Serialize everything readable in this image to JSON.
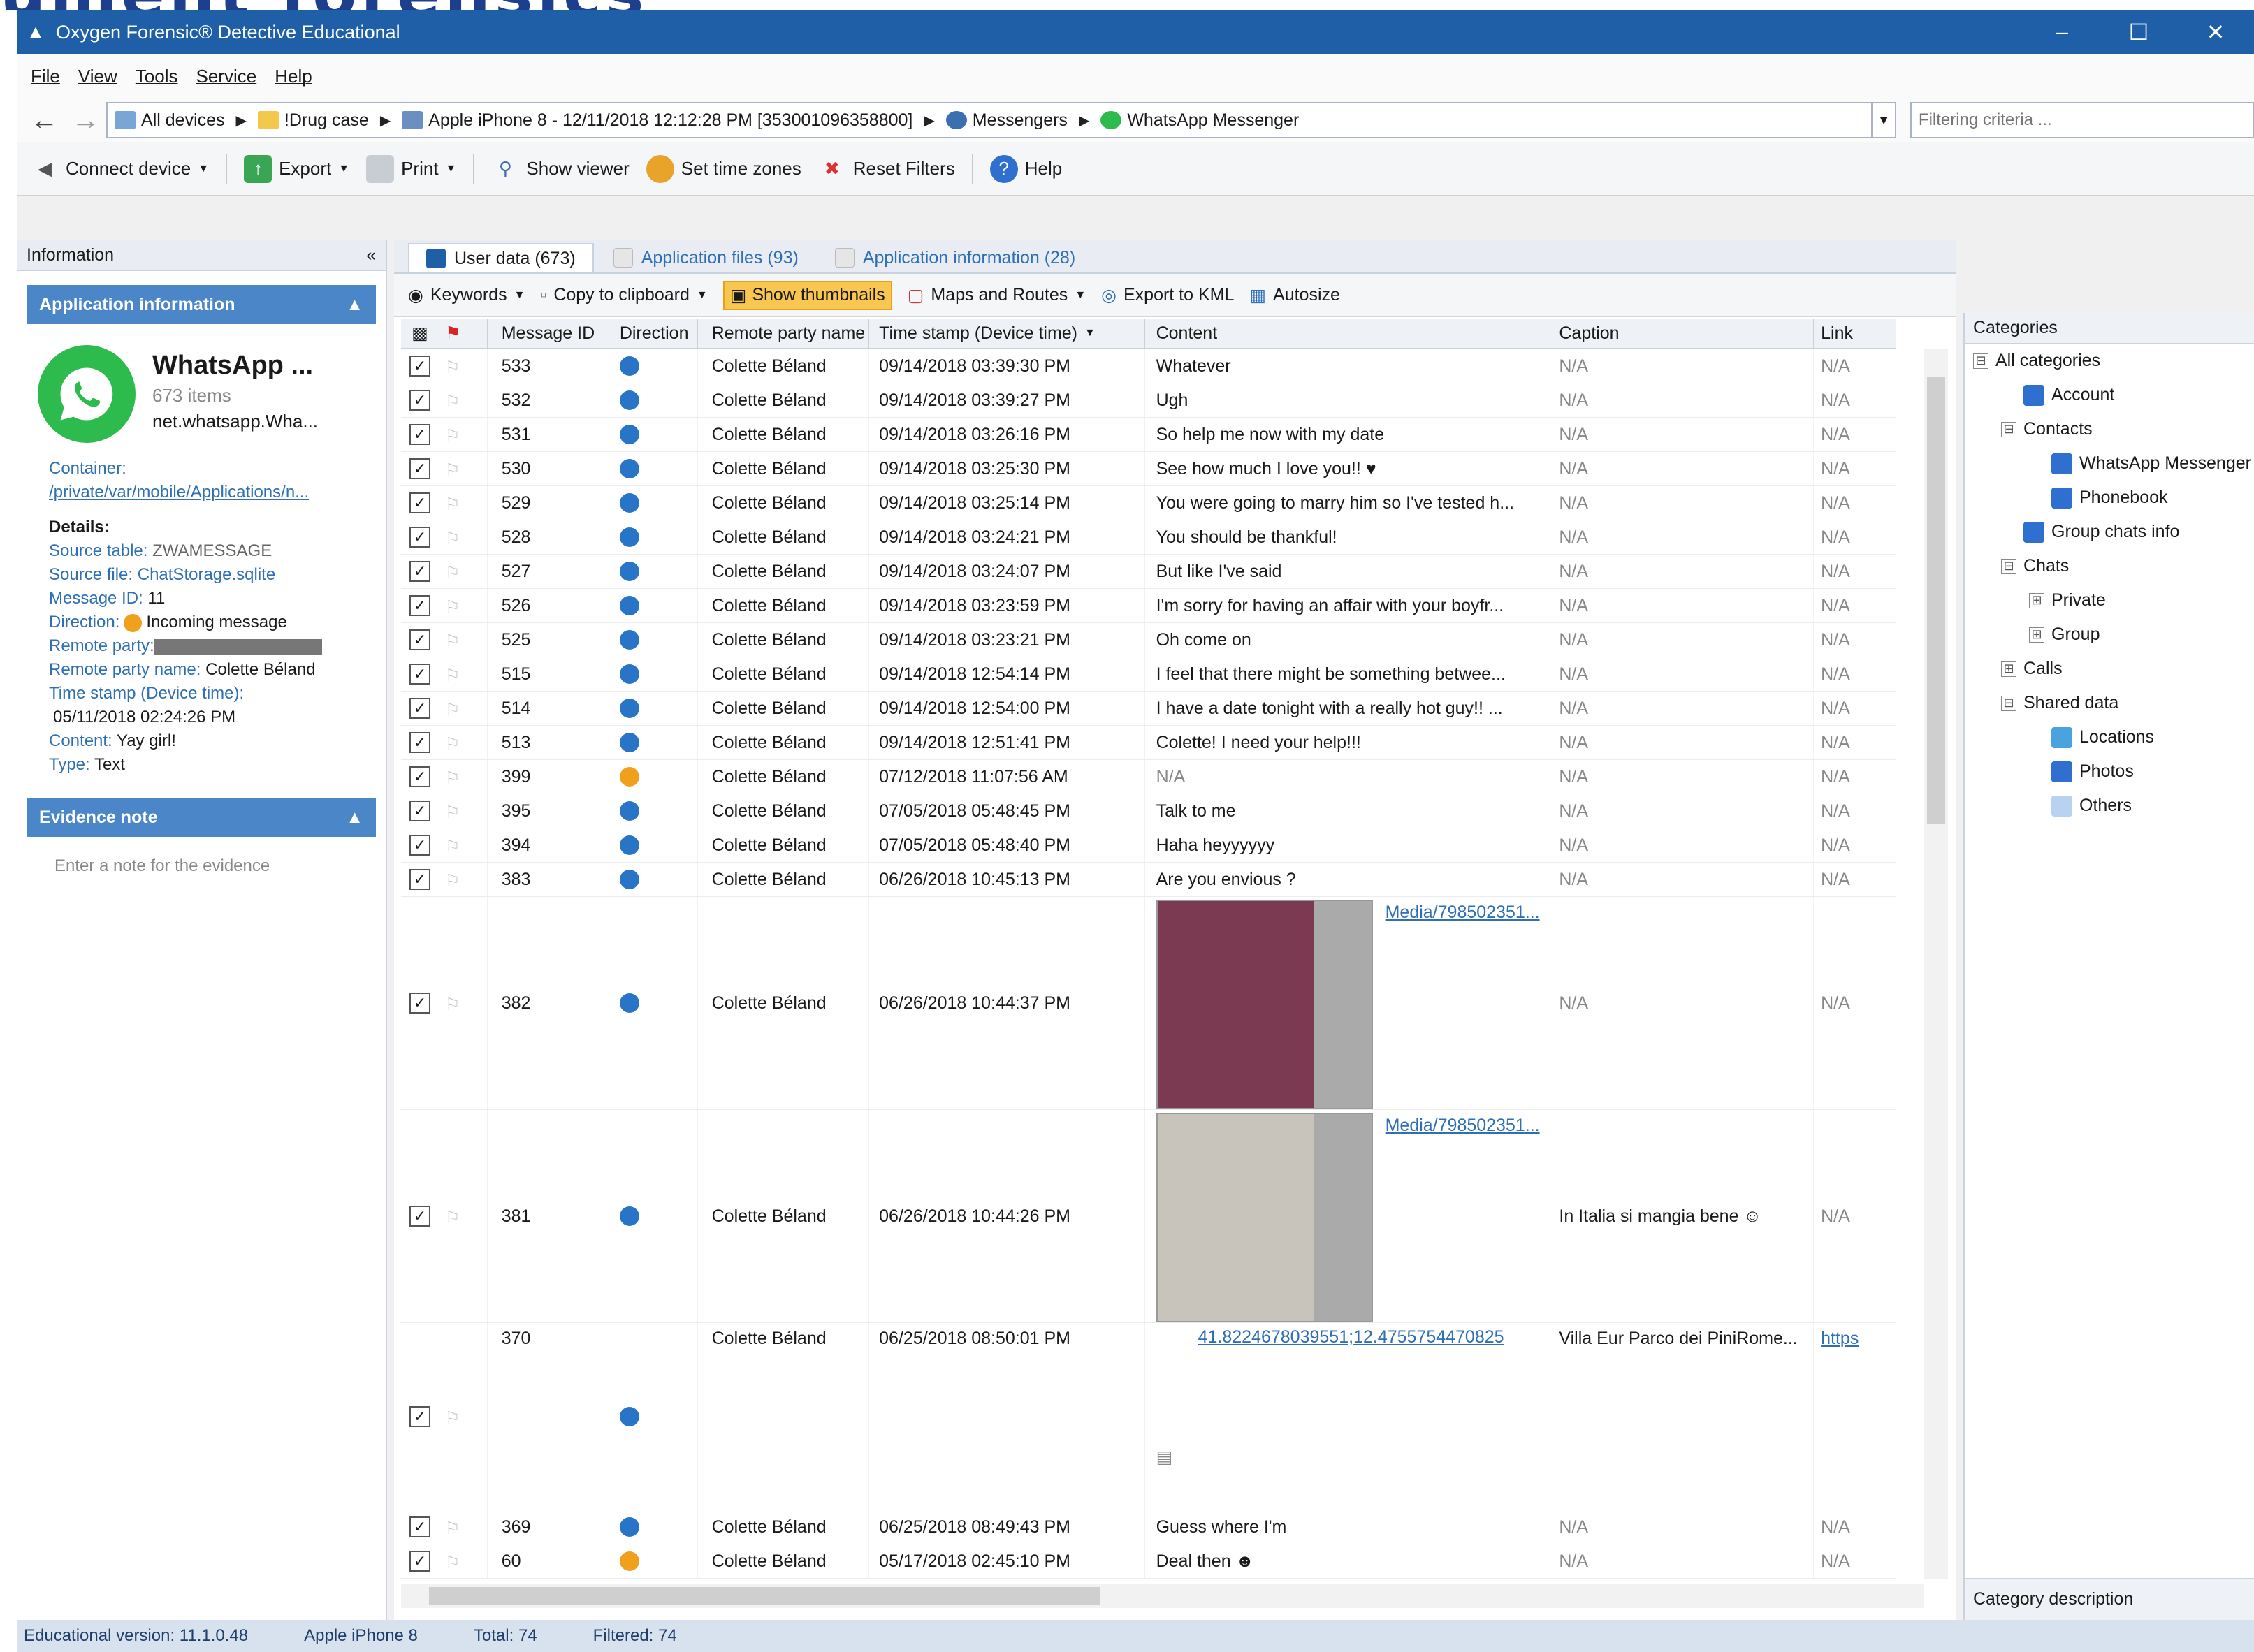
{
  "window": {
    "title": "Oxygen Forensic® Detective Educational",
    "controls": [
      "–",
      "☐",
      "✕"
    ]
  },
  "menu": [
    "File",
    "View",
    "Tools",
    "Service",
    "Help"
  ],
  "breadcrumb": {
    "items": [
      {
        "label": "All devices",
        "icon": "devices-icon",
        "color": "#7aa6d6"
      },
      {
        "label": "!Drug case",
        "icon": "folder-icon",
        "color": "#f2c94c"
      },
      {
        "label": "Apple iPhone 8 - 12/11/2018 12:12:28 PM [353001096358800]",
        "icon": "phone-icon",
        "color": "#6a8fc0"
      },
      {
        "label": "Messengers",
        "icon": "messengers-icon",
        "color": "#3a6fb0"
      },
      {
        "label": "WhatsApp Messenger",
        "icon": "whatsapp-icon",
        "color": "#2dbb4d"
      }
    ],
    "filter_placeholder": "Filtering criteria ..."
  },
  "toolbar": {
    "connect": "Connect device",
    "export": "Export",
    "print": "Print",
    "show_viewer": "Show viewer",
    "set_time_zones": "Set time zones",
    "reset_filters": "Reset Filters",
    "help": "Help"
  },
  "left": {
    "header": "Information",
    "collapse": "«",
    "app_section": "Application information",
    "app_name": "WhatsApp ...",
    "app_count": "673 items",
    "app_pkg": "net.whatsapp.Wha...",
    "container_label": "Container:",
    "container_path": "/private/var/mobile/Applications/n...",
    "details_label": "Details:",
    "details": {
      "source_table_k": "Source table:",
      "source_table_v": "ZWAMESSAGE",
      "source_file_k": "Source file:",
      "source_file_v": "ChatStorage.sqlite",
      "message_id_k": "Message ID:",
      "message_id_v": "11",
      "direction_k": "Direction:",
      "direction_v": "Incoming message",
      "remote_party_k": "Remote party:",
      "remote_name_k": "Remote party name:",
      "remote_name_v": "Colette Béland",
      "timestamp_k": "Time stamp (Device time):",
      "timestamp_v": "05/11/2018 02:24:26 PM",
      "content_k": "Content:",
      "content_v": "Yay girl!",
      "type_k": "Type:",
      "type_v": "Text"
    },
    "evidence_section": "Evidence note",
    "note_placeholder": "Enter a note for the evidence"
  },
  "tabs": [
    {
      "label": "User data (673)",
      "active": true
    },
    {
      "label": "Application files (93)",
      "active": false
    },
    {
      "label": "Application information (28)",
      "active": false
    }
  ],
  "subtoolbar": {
    "keywords": "Keywords",
    "copy": "Copy to clipboard",
    "thumbnails": "Show thumbnails",
    "maps": "Maps and Routes",
    "kml": "Export to KML",
    "autosize": "Autosize"
  },
  "grid": {
    "columns": [
      "Message ID",
      "Direction",
      "Remote party name",
      "Time stamp (Device time)",
      "Content",
      "Caption",
      "Link"
    ],
    "rows": [
      {
        "id": "533",
        "dir": "out",
        "party": "Colette Béland",
        "time": "09/14/2018 03:39:30 PM",
        "content": "Whatever",
        "caption": "N/A",
        "link": "N/A"
      },
      {
        "id": "532",
        "dir": "out",
        "party": "Colette Béland",
        "time": "09/14/2018 03:39:27 PM",
        "content": "Ugh",
        "caption": "N/A",
        "link": "N/A"
      },
      {
        "id": "531",
        "dir": "out",
        "party": "Colette Béland",
        "time": "09/14/2018 03:26:16 PM",
        "content": "So help me now with my date",
        "caption": "N/A",
        "link": "N/A"
      },
      {
        "id": "530",
        "dir": "out",
        "party": "Colette Béland",
        "time": "09/14/2018 03:25:30 PM",
        "content": "See how much I love you!! ♥",
        "caption": "N/A",
        "link": "N/A"
      },
      {
        "id": "529",
        "dir": "out",
        "party": "Colette Béland",
        "time": "09/14/2018 03:25:14 PM",
        "content": "You were going to marry him so I've tested h...",
        "caption": "N/A",
        "link": "N/A"
      },
      {
        "id": "528",
        "dir": "out",
        "party": "Colette Béland",
        "time": "09/14/2018 03:24:21 PM",
        "content": "You should be thankful!",
        "caption": "N/A",
        "link": "N/A"
      },
      {
        "id": "527",
        "dir": "out",
        "party": "Colette Béland",
        "time": "09/14/2018 03:24:07 PM",
        "content": "But like I've said",
        "caption": "N/A",
        "link": "N/A"
      },
      {
        "id": "526",
        "dir": "out",
        "party": "Colette Béland",
        "time": "09/14/2018 03:23:59 PM",
        "content": "I'm sorry for having an affair with your boyfr...",
        "caption": "N/A",
        "link": "N/A"
      },
      {
        "id": "525",
        "dir": "out",
        "party": "Colette Béland",
        "time": "09/14/2018 03:23:21 PM",
        "content": "Oh come on",
        "caption": "N/A",
        "link": "N/A"
      },
      {
        "id": "515",
        "dir": "out",
        "party": "Colette Béland",
        "time": "09/14/2018 12:54:14 PM",
        "content": "I feel that there might be something betwee...",
        "caption": "N/A",
        "link": "N/A"
      },
      {
        "id": "514",
        "dir": "out",
        "party": "Colette Béland",
        "time": "09/14/2018 12:54:00 PM",
        "content": "I have a date tonight with a really hot guy!! ...",
        "caption": "N/A",
        "link": "N/A"
      },
      {
        "id": "513",
        "dir": "out",
        "party": "Colette Béland",
        "time": "09/14/2018 12:51:41 PM",
        "content": "Colette! I need your help!!!",
        "caption": "N/A",
        "link": "N/A"
      },
      {
        "id": "399",
        "dir": "in",
        "party": "Colette Béland",
        "time": "07/12/2018 11:07:56 AM",
        "content": "N/A",
        "caption": "N/A",
        "link": "N/A"
      },
      {
        "id": "395",
        "dir": "out",
        "party": "Colette Béland",
        "time": "07/05/2018 05:48:45 PM",
        "content": "Talk to me",
        "caption": "N/A",
        "link": "N/A"
      },
      {
        "id": "394",
        "dir": "out",
        "party": "Colette Béland",
        "time": "07/05/2018 05:48:40 PM",
        "content": "Haha heyyyyyy",
        "caption": "N/A",
        "link": "N/A"
      },
      {
        "id": "383",
        "dir": "out",
        "party": "Colette Béland",
        "time": "06/26/2018 10:45:13 PM",
        "content": "Are you envious ?",
        "caption": "N/A",
        "link": "N/A"
      }
    ],
    "media_rows": [
      {
        "id": "382",
        "party": "Colette Béland",
        "time": "06/26/2018 10:44:37 PM",
        "media": "Media/798502351...",
        "caption": "N/A",
        "link": "N/A"
      },
      {
        "id": "381",
        "party": "Colette Béland",
        "time": "06/26/2018 10:44:26 PM",
        "media": "Media/798502351...",
        "caption": "In Italia si mangia bene ☺",
        "link": "N/A"
      }
    ],
    "location_row": {
      "id": "370",
      "party": "Colette Béland",
      "time": "06/25/2018 08:50:01 PM",
      "coords": "41.8224678039551;12.4755754470825",
      "caption": "Villa Eur Parco dei PiniRome...",
      "link": "https"
    },
    "tail_rows": [
      {
        "id": "369",
        "dir": "out",
        "party": "Colette Béland",
        "time": "06/25/2018 08:49:43 PM",
        "content": "Guess where I'm",
        "caption": "N/A",
        "link": "N/A"
      },
      {
        "id": "60",
        "dir": "in",
        "party": "Colette Béland",
        "time": "05/17/2018 02:45:10 PM",
        "content": "Deal then ☻",
        "caption": "N/A",
        "link": "N/A"
      }
    ]
  },
  "categories": {
    "header": "Categories",
    "nodes": [
      {
        "label": "All categories",
        "indent": 0,
        "toggle": "⊟",
        "icon": ""
      },
      {
        "label": "Account",
        "indent": 1,
        "toggle": "",
        "icon": "account-icon"
      },
      {
        "label": "Contacts",
        "indent": 1,
        "toggle": "⊟",
        "icon": ""
      },
      {
        "label": "WhatsApp Messenger",
        "indent": 2,
        "toggle": "",
        "icon": "contact-icon"
      },
      {
        "label": "Phonebook",
        "indent": 2,
        "toggle": "",
        "icon": "contact-icon"
      },
      {
        "label": "Group chats info",
        "indent": 1,
        "toggle": "",
        "icon": "group-icon"
      },
      {
        "label": "Chats",
        "indent": 1,
        "toggle": "⊟",
        "icon": ""
      },
      {
        "label": "Private",
        "indent": 2,
        "toggle": "⊞",
        "icon": ""
      },
      {
        "label": "Group",
        "indent": 2,
        "toggle": "⊞",
        "icon": ""
      },
      {
        "label": "Calls",
        "indent": 1,
        "toggle": "⊞",
        "icon": ""
      },
      {
        "label": "Shared data",
        "indent": 1,
        "toggle": "⊟",
        "icon": ""
      },
      {
        "label": "Locations",
        "indent": 2,
        "toggle": "",
        "icon": "location-icon"
      },
      {
        "label": "Photos",
        "indent": 2,
        "toggle": "",
        "icon": "photos-icon"
      },
      {
        "label": "Others",
        "indent": 2,
        "toggle": "",
        "icon": "others-icon"
      }
    ],
    "footer": "Category description"
  },
  "status": {
    "version": "Educational version: 11.1.0.48",
    "device": "Apple iPhone 8",
    "total": "Total: 74",
    "filtered": "Filtered: 74"
  },
  "colors": {
    "accent": "#1f5fa8",
    "whatsapp": "#2dbb4d",
    "outgoing": "#2874c6",
    "incoming": "#f0a01c"
  }
}
